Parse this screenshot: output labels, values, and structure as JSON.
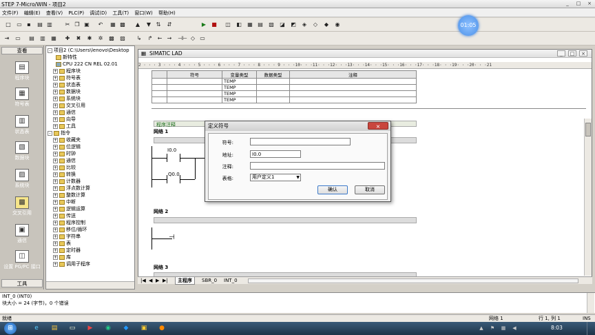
{
  "app": {
    "title": "STEP 7-Micro/WIN - 项目2",
    "window_buttons": [
      "_",
      "□",
      "×"
    ]
  },
  "menu": [
    "文件(F)",
    "编辑(E)",
    "查看(V)",
    "PLC(P)",
    "调试(D)",
    "工具(T)",
    "窗口(W)",
    "帮助(H)"
  ],
  "overlay": {
    "timer": "01:05"
  },
  "nav": {
    "header": "查看",
    "items": [
      "程序块",
      "符号表",
      "状态表",
      "数据块",
      "系统块",
      "交叉引用",
      "通信",
      "设置 PG/PC 接口"
    ],
    "footer": "工具"
  },
  "tree": {
    "project": "项目2 (C:\\Users\\lenovo\\Desktop",
    "items": [
      "新特性",
      "CPU 222 CN REL 02.01",
      "程序块",
      "符号表",
      "状态表",
      "数据块",
      "系统块",
      "交叉引用",
      "通信",
      "向导",
      "工具",
      "指令",
      "收藏夹",
      "位逻辑",
      "时钟",
      "通信",
      "比较",
      "转换",
      "计数器",
      "浮点数计算",
      "整数计算",
      "中断",
      "逻辑运算",
      "传送",
      "程序控制",
      "移位/循环",
      "字符串",
      "表",
      "定时器",
      "库",
      "调用子程序"
    ]
  },
  "lad": {
    "title": "SIMATIC LAD",
    "ruler": "2 · · · 3 · · · 4 · · · 5 · · · 6 · · · 7 · · · 8 · · · 9 · · ·10· · ·11· · ·12· · ·13· · ·14· · ·15· · ·16· · ·17· · ·18· · ·19· · ·20· · ·21",
    "var_headers": [
      "符号",
      "变量类型",
      "数据类型",
      "注释"
    ],
    "var_rows": [
      "TEMP",
      "TEMP",
      "TEMP",
      "TEMP"
    ],
    "program_comment": "程序注释",
    "network1": "网络 1",
    "network2": "网络 2",
    "network3": "网络 3",
    "contact1": "I0.0",
    "contact2": "Q0.0",
    "tabs": [
      "主程序",
      "SBR_0",
      "INT_0"
    ]
  },
  "dialog": {
    "title": "定义符号",
    "close": "×",
    "symbol_label": "符号:",
    "symbol_value": "",
    "address_label": "地址:",
    "address_value": "I0.0",
    "comment_label": "注释:",
    "comment_value": "",
    "table_label": "表格:",
    "table_value": "用户定义1",
    "ok": "确认",
    "cancel": "取消"
  },
  "output": {
    "line1": "INT_0 (INT0)",
    "line2": "块大小 = 24 (字节)，0 个错误"
  },
  "status": {
    "left": "就绪",
    "network": "网络 1",
    "position": "行 1, 列 1",
    "mode": "INS"
  },
  "taskbar": {
    "time": "8:03"
  }
}
